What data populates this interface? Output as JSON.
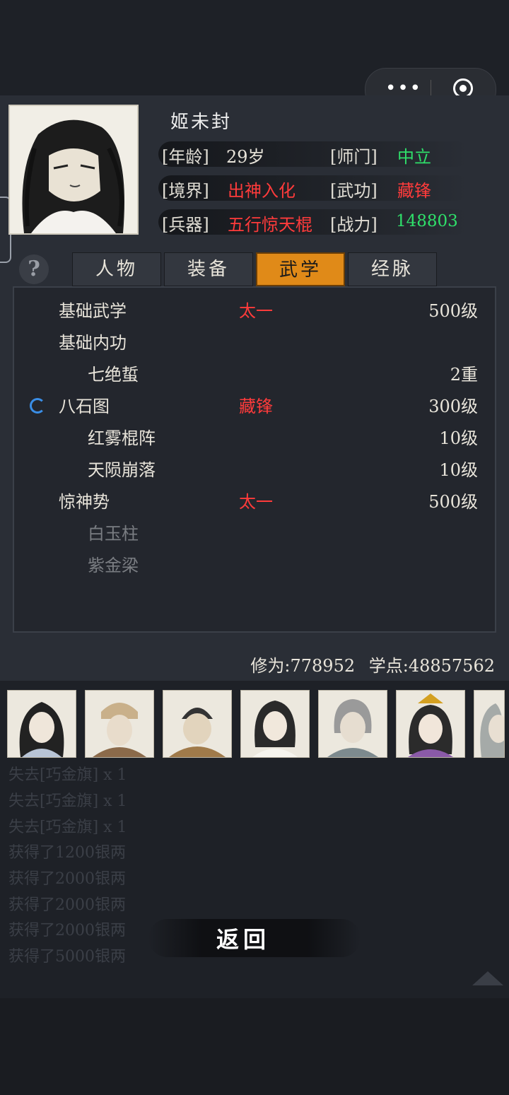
{
  "character": {
    "name": "姬未封",
    "age_label": "[年龄]",
    "age": "29岁",
    "sect_label": "[师门]",
    "sect": "中立",
    "realm_label": "[境界]",
    "realm": "出神入化",
    "martial_label": "[武功]",
    "martial": "藏锋",
    "weapon_label": "[兵器]",
    "weapon": "五行惊天棍",
    "power_label": "[战力]",
    "power": "148803"
  },
  "tabs": [
    {
      "label": "人物",
      "active": false
    },
    {
      "label": "装备",
      "active": false
    },
    {
      "label": "武学",
      "active": true
    },
    {
      "label": "经脉",
      "active": false
    }
  ],
  "help_icon": "question-icon",
  "skills": [
    {
      "name": "基础武学",
      "style": "太一",
      "level": "500级",
      "indent": false,
      "dim": false,
      "loading": false
    },
    {
      "name": "基础内功",
      "style": "",
      "level": "",
      "indent": false,
      "dim": false,
      "loading": false
    },
    {
      "name": "七绝蜇",
      "style": "",
      "level": "2重",
      "indent": true,
      "dim": false,
      "loading": false
    },
    {
      "name": "八石图",
      "style": "藏锋",
      "level": "300级",
      "indent": false,
      "dim": false,
      "loading": true
    },
    {
      "name": "红雾棍阵",
      "style": "",
      "level": "10级",
      "indent": true,
      "dim": false,
      "loading": false
    },
    {
      "name": "天陨崩落",
      "style": "",
      "level": "10级",
      "indent": true,
      "dim": false,
      "loading": false
    },
    {
      "name": "惊神势",
      "style": "太一",
      "level": "500级",
      "indent": false,
      "dim": false,
      "loading": false
    },
    {
      "name": "白玉柱",
      "style": "",
      "level": "",
      "indent": true,
      "dim": true,
      "loading": false
    },
    {
      "name": "紫金梁",
      "style": "",
      "level": "",
      "indent": true,
      "dim": true,
      "loading": false
    }
  ],
  "stats": {
    "cultivation": "修为:778952",
    "points": "学点:48857562"
  },
  "log": [
    "失去[巧金旗] x 1",
    "失去[巧金旗] x 1",
    "失去[巧金旗] x 1",
    "获得了1200银两",
    "获得了2000银两",
    "获得了2000银两",
    "获得了2000银两",
    "获得了5000银两"
  ],
  "back_label": "返回",
  "colors": {
    "accent_tab": "#e08a18",
    "red": "#ff3b3b",
    "green": "#2fe06a",
    "spinner": "#3a8ee6"
  }
}
